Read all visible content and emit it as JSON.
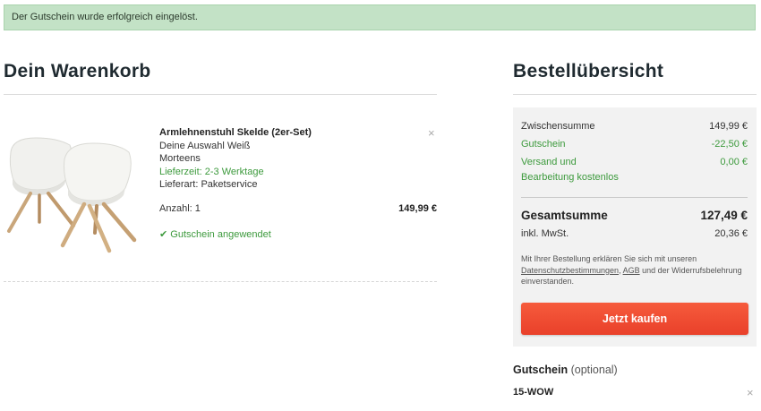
{
  "alert": {
    "text": "Der Gutschein wurde erfolgreich eingelöst."
  },
  "cart": {
    "title": "Dein Warenkorb",
    "item": {
      "name": "Armlehnenstuhl Skelde (2er-Set)",
      "variant": "Deine Auswahl Weiß",
      "brand": "Morteens",
      "delivery_time": "Lieferzeit: 2-3 Werktage",
      "delivery_type": "Lieferart: Paketservice",
      "quantity": "Anzahl: 1",
      "price": "149,99 €",
      "voucher_applied": "✔ Gutschein angewendet",
      "remove_symbol": "×"
    }
  },
  "summary": {
    "title": "Bestellübersicht",
    "rows": [
      {
        "label": "Zwischensumme",
        "value": "149,99 €"
      },
      {
        "label": "Gutschein",
        "value": "-22,50 €"
      },
      {
        "label": "Versand und",
        "value": "0,00 €"
      },
      {
        "label": "Bearbeitung kostenlos",
        "value": ""
      }
    ],
    "total_label": "Gesamtsumme",
    "total_value": "127,49 €",
    "vat_label": "inkl. MwSt.",
    "vat_value": "20,36 €",
    "legal": {
      "before": "Mit Ihrer Bestellung erklären Sie sich mit unseren ",
      "privacy_link": "Datenschutzbestimmungen",
      "comma": ", ",
      "agb_link": "AGB",
      "after": " und der Widerrufsbelehrung einverstanden."
    },
    "buy_button": "Jetzt kaufen"
  },
  "voucher": {
    "heading": "Gutschein",
    "optional": "(optional)",
    "code": "15-WOW",
    "remove_symbol": "×"
  },
  "colors": {
    "alert_bg": "#c3e2c6",
    "green": "#3d9a3d",
    "buy_button": "#f04e33",
    "summary_bg": "#f2f2f2"
  }
}
